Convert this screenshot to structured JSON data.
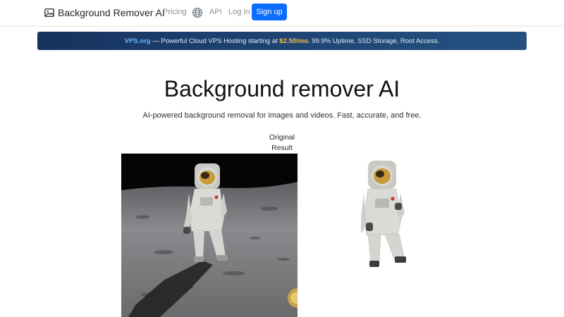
{
  "navbar": {
    "brand": "Background Remover AI",
    "links": {
      "pricing": "Pricing",
      "api": "API",
      "login": "Log In"
    },
    "signup": "Sign up"
  },
  "promo": {
    "brand": "VPS.org",
    "text_before_price": " — Powerful Cloud VPS Hosting starting at ",
    "price": "$2.50/mo.",
    "text_after_price": " 99.9% Uptime, SSD Storage, Root Access."
  },
  "hero": {
    "title": "Background remover AI",
    "subtitle": "AI-powered background removal for images and videos. Fast, accurate, and free."
  },
  "comparison": {
    "original_label": "Original",
    "result_label": "Result"
  },
  "colors": {
    "accent": "#0d6efd",
    "promo_bg": "#1e4474",
    "promo_link": "#69b4ff",
    "promo_price": "#f6c343"
  },
  "icons": {
    "brand": "image-icon",
    "language": "globe-icon"
  }
}
